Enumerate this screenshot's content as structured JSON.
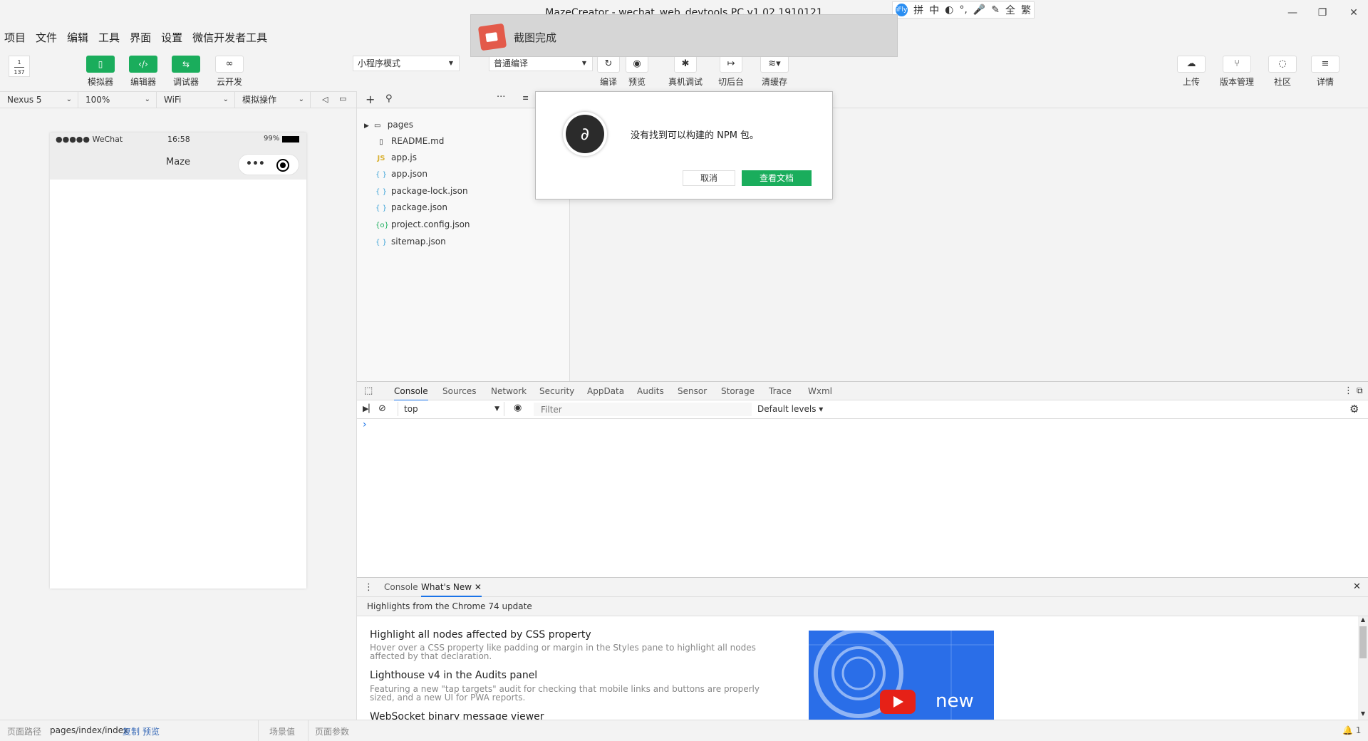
{
  "window": {
    "title": "MazeCreator - wechat_web_devtools PC v1.02.1910121",
    "minimize": "—",
    "restore": "❐",
    "close": "✕"
  },
  "ime": {
    "logo": "iFly",
    "items": [
      "拼",
      "中",
      "◐",
      "°,",
      "🎤",
      "✎",
      "全",
      "繁"
    ]
  },
  "menu": [
    "项目",
    "文件",
    "编辑",
    "工具",
    "界面",
    "设置",
    "微信开发者工具"
  ],
  "toast": {
    "text": "截图完成"
  },
  "toolbar": {
    "avatar_text_top": "1",
    "avatar_text_bottom": "137",
    "simulator": "模拟器",
    "editor": "编辑器",
    "debugger": "调试器",
    "cloud": "云开发",
    "mode_select": "小程序模式",
    "compile_select": "普通编译",
    "compile": "编译",
    "preview": "预览",
    "remote_debug": "真机调试",
    "background": "切后台",
    "clear_cache": "清缓存",
    "upload": "上传",
    "version": "版本管理",
    "community": "社区",
    "details": "详情"
  },
  "devicebar": {
    "device": "Nexus 5",
    "zoom": "100%",
    "network": "WiFi",
    "operation": "模拟操作"
  },
  "phone": {
    "carrier": "●●●●● WeChat",
    "time": "16:58",
    "battery": "99%",
    "title": "Maze",
    "capsule_more": "•••"
  },
  "filetree": {
    "items": [
      {
        "name": "pages",
        "type": "folder"
      },
      {
        "name": "README.md",
        "type": "md"
      },
      {
        "name": "app.js",
        "type": "js"
      },
      {
        "name": "app.json",
        "type": "json"
      },
      {
        "name": "package-lock.json",
        "type": "json"
      },
      {
        "name": "package.json",
        "type": "json"
      },
      {
        "name": "project.config.json",
        "type": "config"
      },
      {
        "name": "sitemap.json",
        "type": "json"
      }
    ]
  },
  "devtools": {
    "tabs": [
      "Console",
      "Sources",
      "Network",
      "Security",
      "AppData",
      "Audits",
      "Sensor",
      "Storage",
      "Trace",
      "Wxml"
    ],
    "context": "top",
    "filter_placeholder": "Filter",
    "levels": "Default levels",
    "prompt": "›",
    "drawer_tabs": [
      "Console",
      "What's New"
    ],
    "highlights_header": "Highlights from the Chrome 74 update",
    "whatsnew": [
      {
        "title": "Highlight all nodes affected by CSS property",
        "desc": "Hover over a CSS property like padding or margin in the Styles pane to highlight all nodes affected by that declaration."
      },
      {
        "title": "Lighthouse v4 in the Audits panel",
        "desc": "Featuring a new \"tap targets\" audit for checking that mobile links and buttons are properly sized, and a new UI for PWA reports."
      },
      {
        "title": "WebSocket binary message viewer",
        "desc": ""
      }
    ],
    "video_text": "new"
  },
  "bottombar": {
    "path_label": "页面路径",
    "path": "pages/index/index",
    "copy": "复制",
    "preview": "预览",
    "scene": "场景值",
    "params": "页面参数",
    "notifications": "1"
  },
  "modal": {
    "message": "没有找到可以构建的 NPM 包。",
    "cancel": "取消",
    "docs": "查看文档"
  },
  "colors": {
    "accent_green": "#1aad5c",
    "tab_blue": "#1a73e8",
    "link_blue": "#3a6bb8"
  }
}
